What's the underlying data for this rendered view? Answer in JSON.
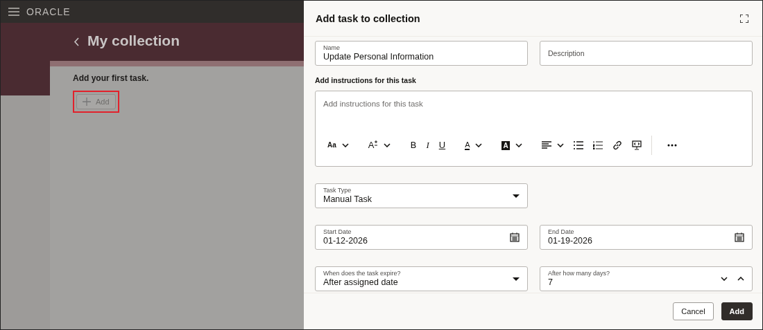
{
  "app_header": {
    "logo": "ORACLE"
  },
  "page": {
    "title": "My collection",
    "empty_message": "Add your first task.",
    "add_button": {
      "label": "Add",
      "highlighted": true
    }
  },
  "drawer": {
    "title": "Add task to collection",
    "name_field": {
      "label": "Name",
      "value": "Update Personal Information"
    },
    "description_field": {
      "placeholder": "Description"
    },
    "instructions": {
      "label": "Add instructions for this task",
      "placeholder": "Add instructions for this task",
      "toolbar": [
        {
          "kind": "font",
          "label": "Aa"
        },
        {
          "kind": "size",
          "label": "A"
        },
        {
          "kind": "bold",
          "label": "B"
        },
        {
          "kind": "italic",
          "label": "I"
        },
        {
          "kind": "underline",
          "label": "U"
        },
        {
          "kind": "color",
          "label": "A"
        },
        {
          "kind": "highlight",
          "label": "A"
        },
        {
          "kind": "align"
        },
        {
          "kind": "bullets"
        },
        {
          "kind": "numbers"
        },
        {
          "kind": "link"
        },
        {
          "kind": "embed"
        },
        {
          "kind": "divider"
        },
        {
          "kind": "more"
        }
      ]
    },
    "task_type": {
      "label": "Task Type",
      "value": "Manual Task"
    },
    "start_date": {
      "label": "Start Date",
      "value": "01-12-2026"
    },
    "end_date": {
      "label": "End Date",
      "value": "01-19-2026"
    },
    "expiry": {
      "label": "When does the task expire?",
      "value": "After assigned date"
    },
    "days": {
      "label": "After how many days?",
      "value": "7"
    },
    "buttons": [
      {
        "label": "Cancel",
        "kind": "secondary"
      },
      {
        "label": "Add",
        "kind": "primary"
      }
    ]
  }
}
